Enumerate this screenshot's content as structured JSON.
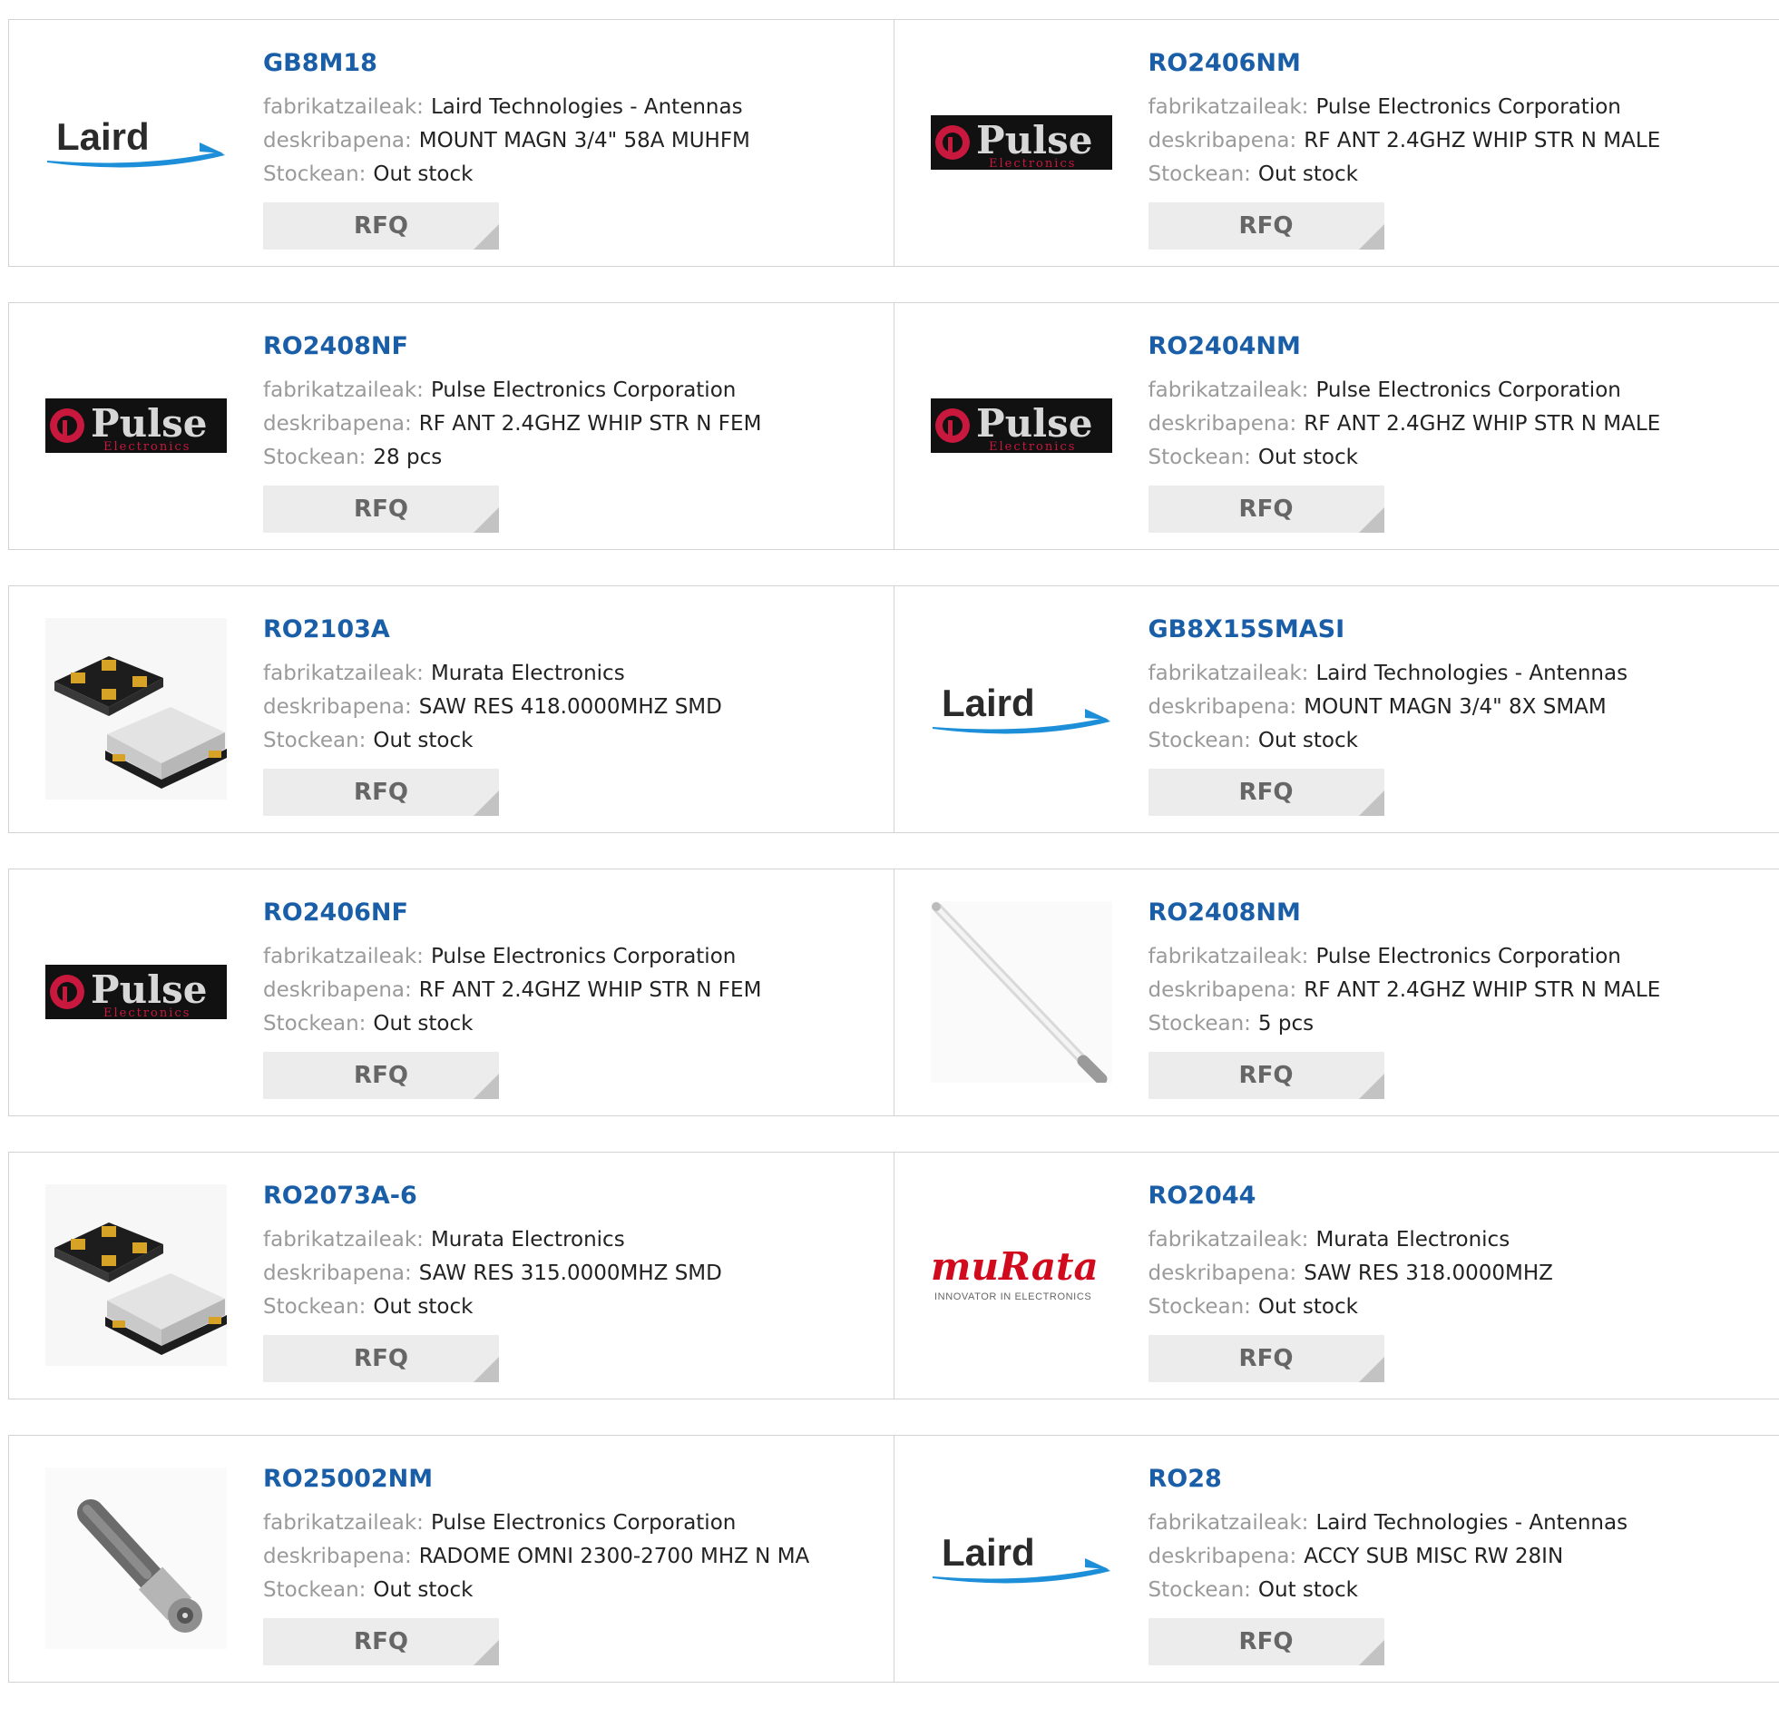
{
  "labels": {
    "manufacturer": "fabrikatzaileak:",
    "description": "deskribapena:",
    "stock": "Stockean:",
    "rfq": "RFQ"
  },
  "brand_colors": {
    "link": "#1a5ea8",
    "laird_blue": "#1d8fd8",
    "pulse_red": "#c8183e",
    "murata_red": "#d10a1e"
  },
  "logo_text": {
    "laird": "Laird",
    "pulse": "Pulse",
    "pulse_sub": "Electronics",
    "murata": "muRata",
    "murata_tag": "INNOVATOR IN ELECTRONICS"
  },
  "products": [
    {
      "part": "GB8M18",
      "manufacturer": "Laird Technologies - Antennas",
      "description": "MOUNT MAGN 3/4\" 58A MUHFM",
      "stock": "Out stock",
      "image": "laird-logo"
    },
    {
      "part": "RO2406NM",
      "manufacturer": "Pulse Electronics Corporation",
      "description": "RF ANT 2.4GHZ WHIP STR N MALE",
      "stock": "Out stock",
      "image": "pulse-logo"
    },
    {
      "part": "RO2408NF",
      "manufacturer": "Pulse Electronics Corporation",
      "description": "RF ANT 2.4GHZ WHIP STR N FEM",
      "stock": "28 pcs",
      "image": "pulse-logo"
    },
    {
      "part": "RO2404NM",
      "manufacturer": "Pulse Electronics Corporation",
      "description": "RF ANT 2.4GHZ WHIP STR N MALE",
      "stock": "Out stock",
      "image": "pulse-logo"
    },
    {
      "part": "RO2103A",
      "manufacturer": "Murata Electronics",
      "description": "SAW RES 418.0000MHZ SMD",
      "stock": "Out stock",
      "image": "saw-resonator-photo"
    },
    {
      "part": "GB8X15SMASI",
      "manufacturer": "Laird Technologies - Antennas",
      "description": "MOUNT MAGN 3/4\" 8X SMAM",
      "stock": "Out stock",
      "image": "laird-logo"
    },
    {
      "part": "RO2406NF",
      "manufacturer": "Pulse Electronics Corporation",
      "description": "RF ANT 2.4GHZ WHIP STR N FEM",
      "stock": "Out stock",
      "image": "pulse-logo"
    },
    {
      "part": "RO2408NM",
      "manufacturer": "Pulse Electronics Corporation",
      "description": "RF ANT 2.4GHZ WHIP STR N MALE",
      "stock": "5 pcs",
      "image": "whip-antenna-photo"
    },
    {
      "part": "RO2073A-6",
      "manufacturer": "Murata Electronics",
      "description": "SAW RES 315.0000MHZ SMD",
      "stock": "Out stock",
      "image": "saw-resonator-photo"
    },
    {
      "part": "RO2044",
      "manufacturer": "Murata Electronics",
      "description": "SAW RES 318.0000MHZ",
      "stock": "Out stock",
      "image": "murata-logo"
    },
    {
      "part": "RO25002NM",
      "manufacturer": "Pulse Electronics Corporation",
      "description": "RADOME OMNI 2300-2700 MHZ N MA",
      "stock": "Out stock",
      "image": "radome-photo"
    },
    {
      "part": "RO28",
      "manufacturer": "Laird Technologies - Antennas",
      "description": "ACCY SUB MISC RW 28IN",
      "stock": "Out stock",
      "image": "laird-logo"
    }
  ]
}
